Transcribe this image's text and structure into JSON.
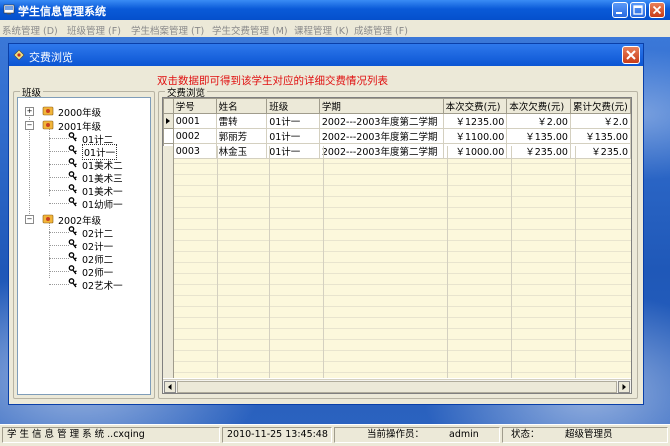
{
  "window": {
    "title": "学生信息管理系统"
  },
  "menu": [
    "系统管理 (D)",
    "班级管理 (F)",
    "学生档案管理 (T)",
    "学生交费管理 (M)",
    "课程管理 (K)",
    "成绩管理 (F)"
  ],
  "child": {
    "title": "交费浏览",
    "hint": "双击数据即可得到该学生对应的详细交费情况列表",
    "class_group_label": "班级",
    "browse_group_label": "交费浏览"
  },
  "tree": [
    {
      "label": "2000年级",
      "expanded": false,
      "children": []
    },
    {
      "label": "2001年级",
      "expanded": true,
      "children": [
        "01计二",
        "01计一",
        "01美术二",
        "01美术三",
        "01美术一",
        "01幼师一"
      ]
    },
    {
      "label": "2002年级",
      "expanded": true,
      "children": [
        "02计二",
        "02计一",
        "02师二",
        "02师一",
        "02艺术一"
      ]
    }
  ],
  "table": {
    "columns": [
      "学号",
      "姓名",
      "班级",
      "学期",
      "本次交费(元)",
      "本次欠费(元)",
      "累计欠费(元)"
    ],
    "rows": [
      [
        "0001",
        "雷转",
        "01计一",
        "2002---2003年度第二学期",
        "￥1235.00",
        "￥2.00",
        "￥2.0"
      ],
      [
        "0002",
        "郭丽芳",
        "01计一",
        "2002---2003年度第二学期",
        "￥1100.00",
        "￥135.00",
        "￥135.00"
      ],
      [
        "0003",
        "林金玉",
        "01计一",
        "2002---2003年度第二学期",
        "￥1000.00",
        "￥235.00",
        "￥235.0"
      ]
    ]
  },
  "status": {
    "app": "学 生 信 息 管 理 系 统 ..cxqing",
    "datetime": "2010-11-25 13:45:48",
    "operator_label": "当前操作员：",
    "operator": "admin",
    "state_label": "状态：",
    "state": "超级管理员"
  },
  "colors": {
    "hint": "#e01010",
    "titlebar": "#0a5ad8",
    "grid_row": "#fcf8dc"
  },
  "icons": {
    "app": "app-icon",
    "folder": "folder-icon",
    "class": "key-icon"
  }
}
